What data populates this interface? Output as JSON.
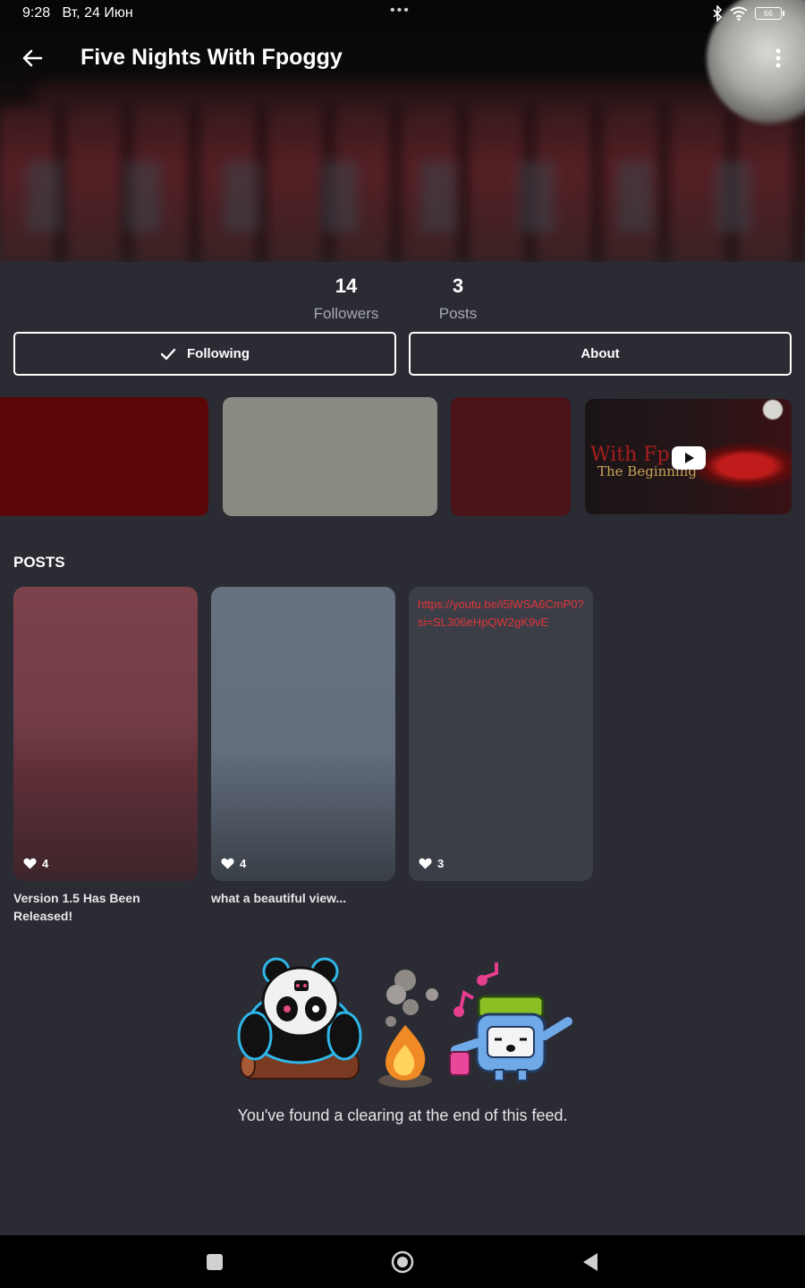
{
  "status_bar": {
    "time": "9:28",
    "date": "Вт, 24 Июн",
    "dots": "•••",
    "battery": "66"
  },
  "header": {
    "title": "Five Nights With Fpoggy"
  },
  "stats": {
    "followers_count": "14",
    "followers_label": "Followers",
    "posts_count": "3",
    "posts_label": "Posts"
  },
  "actions": {
    "following_label": "Following",
    "about_label": "About"
  },
  "gallery": {
    "tiles": [
      {
        "color": "#5c0707"
      },
      {
        "color": "#8b8a82"
      },
      {
        "color": "#4a1319"
      },
      {
        "type": "video",
        "overlay_line1": "With Fp",
        "overlay_line2": "The Beginning"
      }
    ]
  },
  "posts": {
    "section_title": "POSTS",
    "items": [
      {
        "likes": "4",
        "caption": "Version 1.5 Has Been Released!"
      },
      {
        "likes": "4",
        "caption": "what a beautiful view..."
      },
      {
        "likes": "3",
        "link": "https://youtu.be/i5lWSA6CmP0?si=SL306eHpQW2gK9vE",
        "caption": ""
      }
    ]
  },
  "end_of_feed": {
    "message": "You've found a clearing at the end of this feed."
  },
  "colors": {
    "background": "#2a2b33",
    "card_dark": "#3c3e47",
    "link_red": "#e0353a",
    "muted_text": "#a7a8b0"
  }
}
